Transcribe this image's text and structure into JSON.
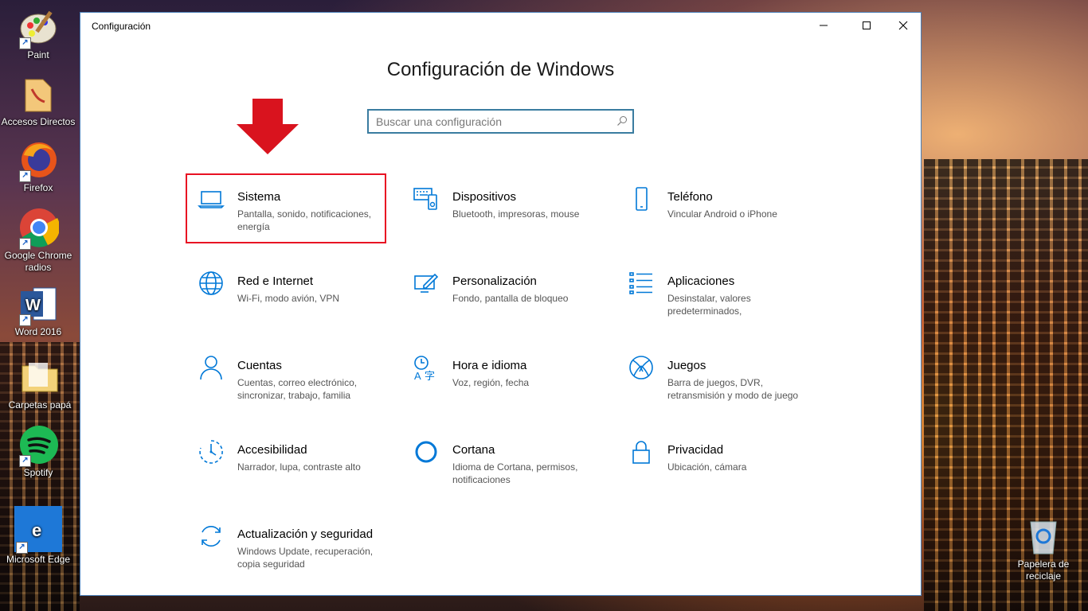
{
  "desktop": {
    "icons": [
      {
        "label": "Paint"
      },
      {
        "label": "Accesos Directos"
      },
      {
        "label": "Firefox"
      },
      {
        "label": "Google Chrome radios"
      },
      {
        "label": "Word 2016"
      },
      {
        "label": "Carpetas papá"
      },
      {
        "label": "Spotify"
      },
      {
        "label": "Microsoft Edge"
      },
      {
        "label": "Papelera de reciclaje"
      }
    ]
  },
  "window": {
    "title": "Configuración",
    "heading": "Configuración de Windows",
    "search": {
      "placeholder": "Buscar una configuración"
    },
    "highlight_color": "#e81123",
    "accent_color": "#0078d7"
  },
  "tiles": [
    {
      "name": "Sistema",
      "desc": "Pantalla, sonido, notificaciones, energía",
      "icon": "laptop-icon",
      "selected": true
    },
    {
      "name": "Dispositivos",
      "desc": "Bluetooth, impresoras, mouse",
      "icon": "devices-icon"
    },
    {
      "name": "Teléfono",
      "desc": "Vincular Android o iPhone",
      "icon": "phone-icon"
    },
    {
      "name": "Red e Internet",
      "desc": "Wi-Fi, modo avión, VPN",
      "icon": "globe-icon"
    },
    {
      "name": "Personalización",
      "desc": "Fondo, pantalla de bloqueo",
      "icon": "personalization-icon"
    },
    {
      "name": "Aplicaciones",
      "desc": "Desinstalar, valores predeterminados,",
      "icon": "apps-list-icon"
    },
    {
      "name": "Cuentas",
      "desc": "Cuentas, correo electrónico, sincronizar, trabajo, familia",
      "icon": "person-icon"
    },
    {
      "name": "Hora e idioma",
      "desc": "Voz, región, fecha",
      "icon": "time-language-icon"
    },
    {
      "name": "Juegos",
      "desc": "Barra de juegos, DVR, retransmisión y modo de juego",
      "icon": "xbox-icon"
    },
    {
      "name": "Accesibilidad",
      "desc": "Narrador, lupa, contraste alto",
      "icon": "accessibility-icon"
    },
    {
      "name": "Cortana",
      "desc": "Idioma de Cortana, permisos, notificaciones",
      "icon": "cortana-icon"
    },
    {
      "name": "Privacidad",
      "desc": "Ubicación, cámara",
      "icon": "lock-icon"
    },
    {
      "name": "Actualización y seguridad",
      "desc": "Windows Update, recuperación, copia seguridad",
      "icon": "update-icon"
    }
  ]
}
